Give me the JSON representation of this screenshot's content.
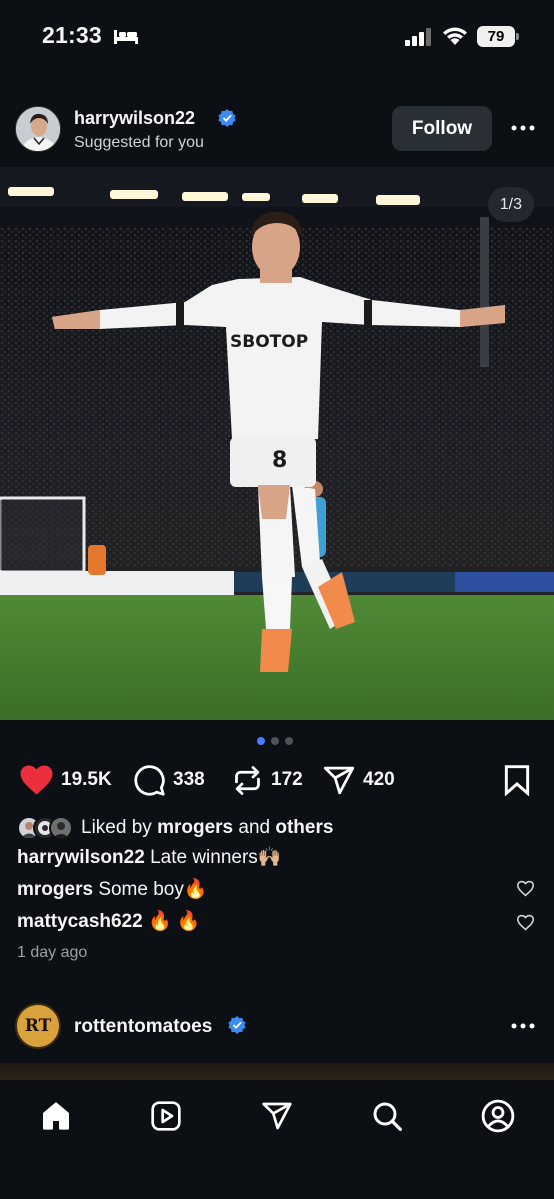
{
  "status_bar": {
    "time": "21:33",
    "battery": "79"
  },
  "post": {
    "username": "harrywilson22",
    "subtitle": "Suggested for you",
    "follow_label": "Follow",
    "page_counter": "1/3",
    "carousel": {
      "total": 3,
      "active": 1
    },
    "counts": {
      "likes": "19.5K",
      "comments": "338",
      "reposts": "172",
      "shares": "420"
    },
    "liked_by": {
      "prefix": "Liked by",
      "user": "mrogers",
      "joiner": "and",
      "others": "others"
    },
    "caption": {
      "user": "harrywilson22",
      "text": "Late winners🙌🏼"
    },
    "comments": [
      {
        "user": "mrogers",
        "text": "Some boy🔥"
      },
      {
        "user": "mattycash622",
        "text": "🔥 🔥"
      }
    ],
    "time_ago": "1 day ago",
    "photo_text": {
      "sponsor": "SBOTOP",
      "number": "8"
    }
  },
  "next_post": {
    "username": "rottentomatoes",
    "logo_text": "RT"
  },
  "nav": [
    "home-icon",
    "video-icon",
    "send-icon",
    "search-icon",
    "profile-icon"
  ],
  "colors": {
    "background": "#0c1014",
    "like": "#ed2f3c",
    "verified": "#3d8bf2",
    "active_dot": "#4a7dff"
  }
}
